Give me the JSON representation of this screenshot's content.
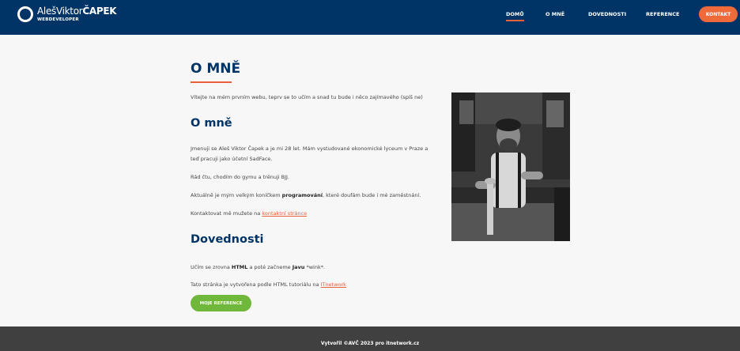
{
  "header": {
    "logo_first": "AlešViktor",
    "logo_last": "ČAPEK",
    "logo_subtitle": "WEBDEVELOPER",
    "nav": [
      {
        "label": "DOMŮ",
        "active": true
      },
      {
        "label": "O MNĚ",
        "active": false
      },
      {
        "label": "DOVEDNOSTI",
        "active": false
      },
      {
        "label": "REFERENCE",
        "active": false
      }
    ],
    "contact_button": "KONTAKT",
    "colors": {
      "background": "#013466",
      "accent": "#ee6a3b"
    }
  },
  "main": {
    "title": "O MNĚ",
    "intro": "Vítejte na mém prvním webu, teprv se to učím a snad tu bude i něco zajímavého (spíš ne)",
    "about_heading": "O mně",
    "about_line1": "Jmenuji se Aleš Viktor Čapek a je mi 28 let. Mám vystudované ekonomické lyceum v Praze a",
    "about_line2": "teď pracuji jako účetní SadFace.",
    "hobbies": "Rád čtu, chodím do gymu a trénuji BJJ.",
    "hobby_prefix": "Aktuálně je mým velkým koníčkem ",
    "hobby_bold": "programování",
    "hobby_suffix": ", které doufám bude i mé zaměstnání.",
    "contact_prefix": "Kontaktovat mě mužete na ",
    "contact_link": "kontaktní stránce",
    "skills_heading": "Dovednosti",
    "skills_prefix": "Učím se zrovna ",
    "skills_html": "HTML",
    "skills_middle": " a poté začneme ",
    "skills_java": "Javu",
    "skills_suffix": " *wink*.",
    "tutorial_prefix": "Tato stránka je vytvořena podle HTML tutoriálu na ",
    "tutorial_link": "ITnetwork",
    "reference_button": "MOJE REFERENCE",
    "photo_icon": "portrait-photo"
  },
  "footer": {
    "text": "Vytvořil ©AVČ 2023 pro itnetwork.cz"
  }
}
